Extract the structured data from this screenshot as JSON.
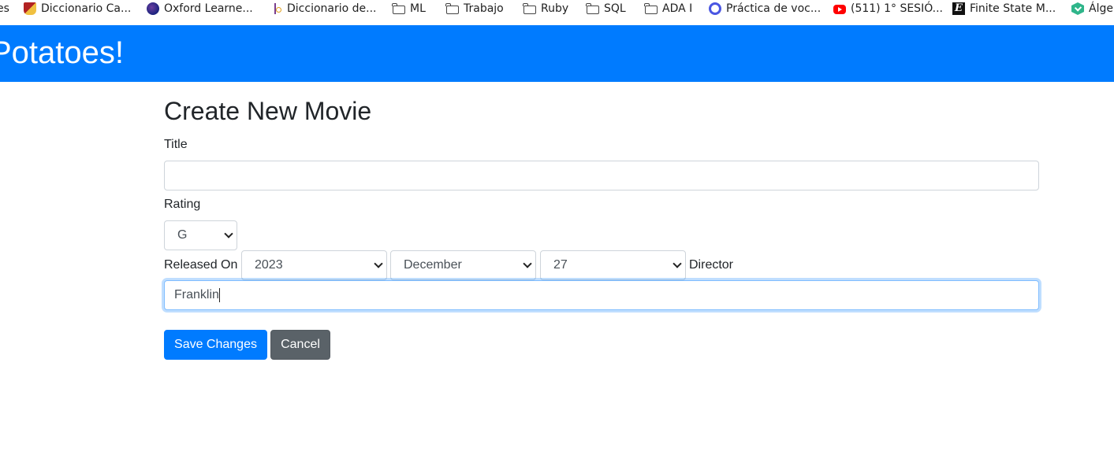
{
  "bookmarks": [
    {
      "icon": "partial-icon",
      "label": "es"
    },
    {
      "icon": "cambridge-shield-icon",
      "label": "Diccionario Ca..."
    },
    {
      "icon": "oxford-globe-icon",
      "label": "Oxford Learne..."
    },
    {
      "icon": "rae-icon",
      "label": "Diccionario de..."
    },
    {
      "icon": "folder-icon",
      "label": "ML"
    },
    {
      "icon": "folder-icon",
      "label": "Trabajo"
    },
    {
      "icon": "folder-icon",
      "label": "Ruby"
    },
    {
      "icon": "folder-icon",
      "label": "SQL"
    },
    {
      "icon": "folder-icon",
      "label": "ADA I"
    },
    {
      "icon": "quizlet-icon",
      "label": "Práctica de voc..."
    },
    {
      "icon": "youtube-icon",
      "label": "(511) 1° SESIÓ..."
    },
    {
      "icon": "fsm-e-icon",
      "label": "Finite State M..."
    },
    {
      "icon": "hexagon-check-icon",
      "label": "Álge"
    }
  ],
  "navbar": {
    "brand": "Potatoes!",
    "color": "#007bff"
  },
  "form": {
    "heading": "Create New Movie",
    "title_label": "Title",
    "title_value": "",
    "rating_label": "Rating",
    "rating_value": "G",
    "released_label": "Released On",
    "year_value": "2023",
    "month_value": "December",
    "day_value": "27",
    "director_label": "Director",
    "director_value": "Franklin",
    "save_label": "Save Changes",
    "cancel_label": "Cancel"
  },
  "colors": {
    "primary": "#007bff",
    "secondary": "#5a6268",
    "focus_border": "#80bdff"
  }
}
